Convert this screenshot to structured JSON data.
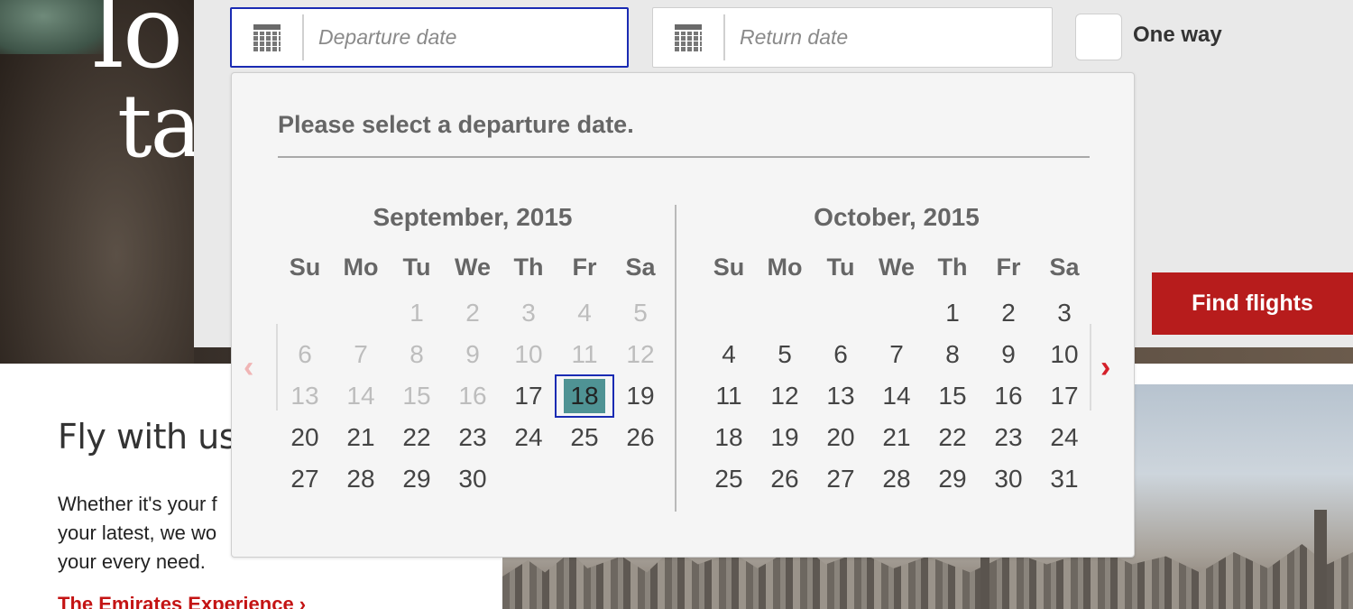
{
  "hero": {
    "text_line1": "lo",
    "text_line2": "tal"
  },
  "search": {
    "departure_placeholder": "Departure date",
    "return_placeholder": "Return date",
    "one_way_label": "One way",
    "find_button": "Find flights"
  },
  "picker": {
    "title": "Please select a departure date.",
    "prev_arrow": "‹",
    "next_arrow": "›",
    "weekdays": [
      "Su",
      "Mo",
      "Tu",
      "We",
      "Th",
      "Fr",
      "Sa"
    ],
    "months": [
      {
        "title": "September, 2015",
        "weeks": [
          [
            "",
            "",
            "1",
            "2",
            "3",
            "4",
            "5"
          ],
          [
            "6",
            "7",
            "8",
            "9",
            "10",
            "11",
            "12"
          ],
          [
            "13",
            "14",
            "15",
            "16",
            "17",
            "18",
            "19"
          ],
          [
            "20",
            "21",
            "22",
            "23",
            "24",
            "25",
            "26"
          ],
          [
            "27",
            "28",
            "29",
            "30",
            "",
            "",
            ""
          ]
        ],
        "disabled_through": "16",
        "selected": "18"
      },
      {
        "title": "October, 2015",
        "weeks": [
          [
            "",
            "",
            "",
            "",
            "1",
            "2",
            "3"
          ],
          [
            "4",
            "5",
            "6",
            "7",
            "8",
            "9",
            "10"
          ],
          [
            "11",
            "12",
            "13",
            "14",
            "15",
            "16",
            "17"
          ],
          [
            "18",
            "19",
            "20",
            "21",
            "22",
            "23",
            "24"
          ],
          [
            "25",
            "26",
            "27",
            "28",
            "29",
            "30",
            "31"
          ]
        ],
        "disabled_through": "",
        "selected": ""
      }
    ]
  },
  "content": {
    "heading": "Fly with us",
    "body": "Whether it's your f\nyour latest, we wo\nyour every need.",
    "link": "The Emirates Experience ›"
  },
  "colors": {
    "accent_red": "#b71c1c",
    "selected_day": "#4f9394",
    "focus_border": "#1a2bb3"
  },
  "icons": {
    "field_icon": "calendar-icon",
    "prev": "chevron-left-icon",
    "next": "chevron-right-icon"
  }
}
